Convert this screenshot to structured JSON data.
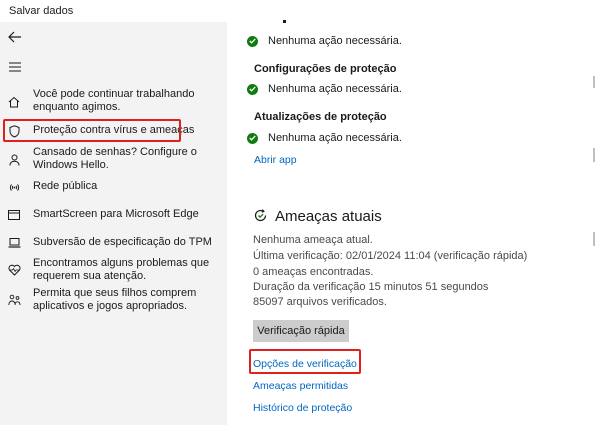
{
  "window": {
    "title": "Salvar dados"
  },
  "sidebar": {
    "items": [
      {
        "label": "Você pode continuar trabalhando enquanto agimos.",
        "icon": "home-icon"
      },
      {
        "label": "Proteção contra vírus e ameaças",
        "icon": "shield-icon"
      },
      {
        "label": "Cansado de senhas? Configure o Windows Hello.",
        "icon": "person-icon"
      },
      {
        "label": "Rede pública",
        "icon": "wifi-icon"
      },
      {
        "label": "SmartScreen para Microsoft Edge",
        "icon": "app-browser-icon"
      },
      {
        "label": "Subversão de especificação do TPM",
        "icon": "laptop-icon"
      },
      {
        "label": "Encontramos alguns problemas que requerem sua atenção.",
        "icon": "heart-pulse-icon"
      },
      {
        "label": "Permita que seus filhos comprem aplicativos e jogos apropriados.",
        "icon": "family-icon"
      }
    ]
  },
  "main": {
    "top_status": "Nenhuma ação necessária.",
    "protection_settings": {
      "title": "Configurações de proteção",
      "status": "Nenhuma ação necessária."
    },
    "protection_updates": {
      "title": "Atualizações de proteção",
      "status": "Nenhuma ação necessária."
    },
    "open_app_link": "Abrir app",
    "threats": {
      "title": "Ameaças atuais",
      "lines": [
        "Nenhuma ameaça atual.",
        "Última verificação: 02/01/2024 11:04 (verificação rápida)",
        "0 ameaças encontradas.",
        "Duração da verificação 15 minutos 51 segundos",
        "85097 arquivos verificados."
      ],
      "quick_scan_button": "Verificação rápida",
      "scan_options_link": "Opções de verificação",
      "allowed_threats_link": "Ameaças permitidas",
      "protection_history_link": "Histórico de proteção"
    }
  },
  "colors": {
    "accent": "#0067c0",
    "highlight": "#e0201c",
    "ok": "#107c10"
  }
}
